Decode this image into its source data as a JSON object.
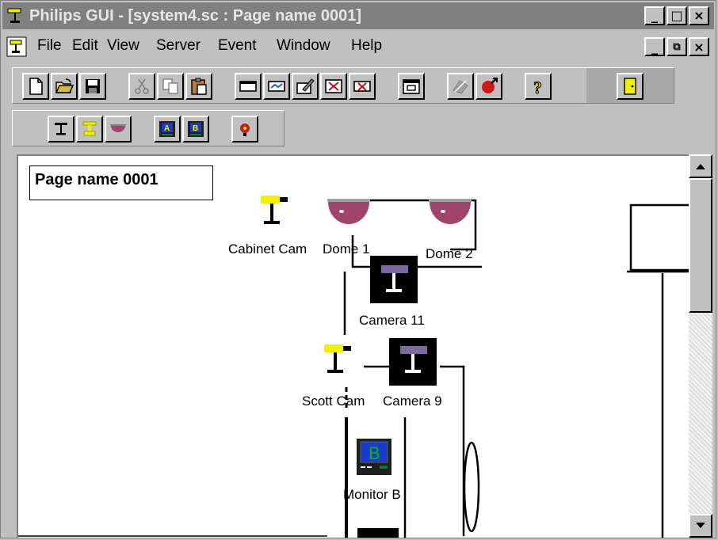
{
  "window": {
    "title": "Philips GUI - [system4.sc : Page name 0001]",
    "minimize_glyph": "_",
    "maximize_glyph": "□",
    "close_glyph": "×",
    "restore_glyph": "⧉"
  },
  "menubar": {
    "items": [
      {
        "label": "File",
        "icon": "none"
      },
      {
        "label": "Edit"
      },
      {
        "label": "View"
      },
      {
        "label": "Server"
      },
      {
        "label": "Event"
      },
      {
        "label": "Window"
      },
      {
        "label": "Help"
      }
    ]
  },
  "toolbar1": {
    "buttons": [
      "new-icon",
      "open-icon",
      "save-icon",
      "cut-icon",
      "copy-icon",
      "paste-icon",
      "rectangle-icon",
      "link-icon",
      "edit-icon",
      "delete-device-icon",
      "delete-link-icon",
      "window-icon",
      "disabled-tool-icon",
      "alarm-icon",
      "help-icon",
      "door-icon"
    ]
  },
  "toolbar2": {
    "buttons": [
      "camera-icon",
      "pan-tilt-camera-icon",
      "dome-icon",
      "monitor-a-icon",
      "monitor-b-icon",
      "alarm-sensor-icon"
    ]
  },
  "canvas": {
    "page_name": "Page name 0001",
    "devices": [
      {
        "label": "Cabinet Cam",
        "icon": "fixed-camera-icon"
      },
      {
        "label": "Dome 1",
        "icon": "dome-camera-icon"
      },
      {
        "label": "Dome 2",
        "icon": "dome-camera-icon"
      },
      {
        "label": "Camera 11",
        "icon": "camera-icon"
      },
      {
        "label": "Scott Cam",
        "icon": "fixed-camera-icon"
      },
      {
        "label": "Camera 9",
        "icon": "camera-icon"
      },
      {
        "label": "Monitor B",
        "icon": "monitor-icon",
        "screen_letter": "B"
      }
    ]
  },
  "colors": {
    "titlebar_inactive": "#808080",
    "face": "#c0c0c0",
    "dome": "#a0456a",
    "camera_yellow": "#f0f000",
    "monitor_screen": "#0a7a3c"
  }
}
